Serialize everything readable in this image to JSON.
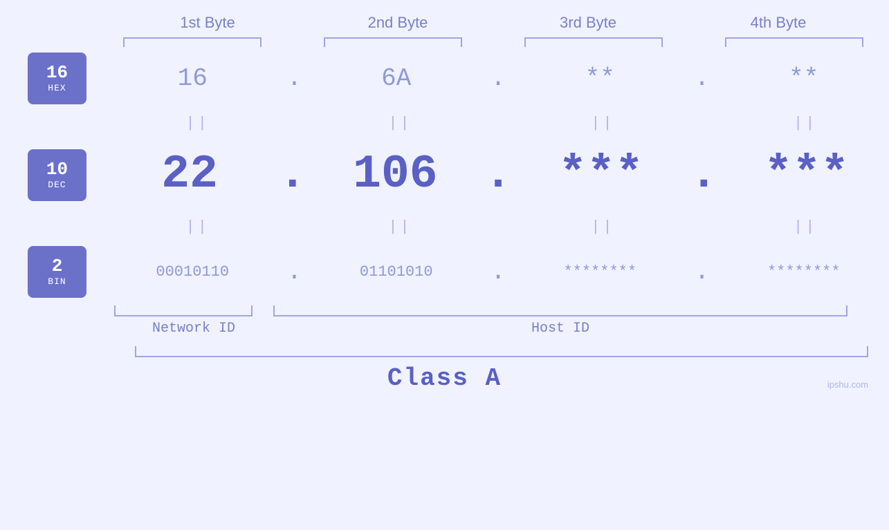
{
  "page": {
    "background_color": "#f0f2ff",
    "watermark": "ipshu.com"
  },
  "headers": {
    "byte1": "1st Byte",
    "byte2": "2nd Byte",
    "byte3": "3rd Byte",
    "byte4": "4th Byte"
  },
  "badges": {
    "hex": {
      "num": "16",
      "label": "HEX"
    },
    "dec": {
      "num": "10",
      "label": "DEC"
    },
    "bin": {
      "num": "2",
      "label": "BIN"
    }
  },
  "values": {
    "hex": {
      "byte1": "16",
      "byte2": "6A",
      "byte3": "**",
      "byte4": "**",
      "dot": "."
    },
    "dec": {
      "byte1": "22",
      "byte2": "106",
      "byte3": "***",
      "byte4": "***",
      "dot": "."
    },
    "bin": {
      "byte1": "00010110",
      "byte2": "01101010",
      "byte3": "********",
      "byte4": "********",
      "dot": "."
    }
  },
  "labels": {
    "network_id": "Network ID",
    "host_id": "Host ID",
    "class": "Class A"
  },
  "equals_symbol": "||"
}
